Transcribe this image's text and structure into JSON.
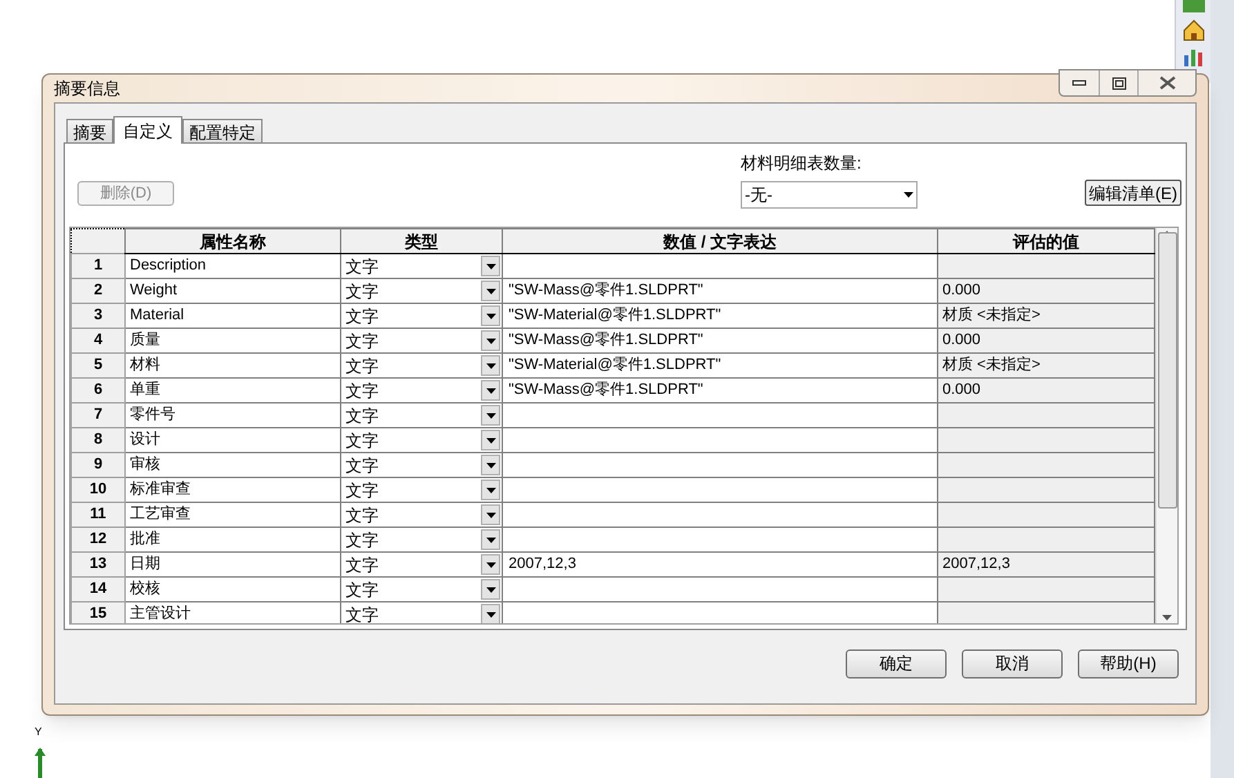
{
  "window": {
    "title": "摘要信息"
  },
  "tabs": [
    {
      "label": "摘要",
      "selected": false
    },
    {
      "label": "自定义",
      "selected": true
    },
    {
      "label": "配置特定",
      "selected": false
    }
  ],
  "delete_button": {
    "label": "删除(D)",
    "disabled": true
  },
  "bom_quantity": {
    "label": "材料明细表数量:",
    "value": "-无-"
  },
  "edit_list_button": {
    "label": "编辑清单(E)"
  },
  "table": {
    "columns": [
      "属性名称",
      "类型",
      "数值 / 文字表达",
      "评估的值"
    ],
    "rows": [
      {
        "index": "1",
        "name": "Description",
        "type": "文字"
      },
      {
        "index": "2",
        "name": "Weight",
        "type": "文字",
        "value": "\"SW-Mass@零件1.SLDPRT\"",
        "evaluated": "0.000"
      },
      {
        "index": "3",
        "name": "Material",
        "type": "文字",
        "value": "\"SW-Material@零件1.SLDPRT\"",
        "evaluated": "材质 <未指定>"
      },
      {
        "index": "4",
        "name": "质量",
        "type": "文字",
        "value": "\"SW-Mass@零件1.SLDPRT\"",
        "evaluated": "0.000"
      },
      {
        "index": "5",
        "name": "材料",
        "type": "文字",
        "value": "\"SW-Material@零件1.SLDPRT\"",
        "evaluated": "材质 <未指定>"
      },
      {
        "index": "6",
        "name": "单重",
        "type": "文字",
        "value": "\"SW-Mass@零件1.SLDPRT\"",
        "evaluated": "0.000"
      },
      {
        "index": "7",
        "name": "零件号",
        "type": "文字"
      },
      {
        "index": "8",
        "name": "设计",
        "type": "文字"
      },
      {
        "index": "9",
        "name": "审核",
        "type": "文字"
      },
      {
        "index": "10",
        "name": "标准审查",
        "type": "文字"
      },
      {
        "index": "11",
        "name": "工艺审查",
        "type": "文字"
      },
      {
        "index": "12",
        "name": "批准",
        "type": "文字"
      },
      {
        "index": "13",
        "name": "日期",
        "type": "文字",
        "value": "2007,12,3",
        "evaluated": "2007,12,3"
      },
      {
        "index": "14",
        "name": "校核",
        "type": "文字"
      },
      {
        "index": "15",
        "name": "主管设计",
        "type": "文字"
      }
    ]
  },
  "buttons": [
    "确定",
    "取消",
    "帮助(H)"
  ],
  "axis_label": "Y"
}
